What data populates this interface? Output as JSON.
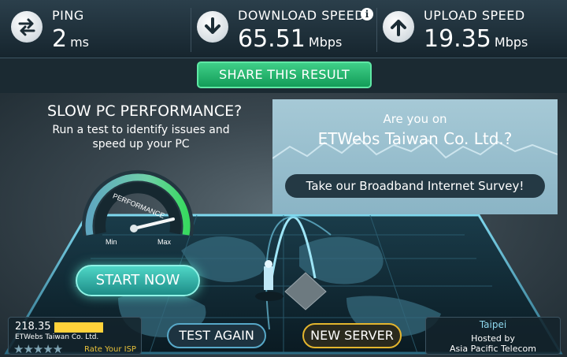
{
  "stats": {
    "ping": {
      "label": "PING",
      "value": "2",
      "unit": "ms",
      "icon": "ping-arrows-icon"
    },
    "download": {
      "label": "DOWNLOAD SPEED",
      "value": "65.51",
      "unit": "Mbps",
      "icon": "download-arrow-icon"
    },
    "upload": {
      "label": "UPLOAD SPEED",
      "value": "19.35",
      "unit": "Mbps",
      "icon": "upload-arrow-icon"
    },
    "info_glyph": "i"
  },
  "share": {
    "label": "SHARE THIS RESULT"
  },
  "promo": {
    "title": "SLOW PC PERFORMANCE?",
    "subtitle": "Run a test to identify issues and speed up your PC",
    "gauge": {
      "label": "PERFORMANCE",
      "min_label": "Min",
      "max_label": "Max"
    },
    "start_label": "START NOW"
  },
  "survey": {
    "line1": "Are you on",
    "line2": "ETWebs Taiwan Co. Ltd.?",
    "button": "Take our Broadband Internet Survey!"
  },
  "footer": {
    "isp": {
      "ip": "218.35",
      "name": "ETWebs Taiwan Co. Ltd.",
      "rate_label": "Rate Your ISP",
      "stars": "★★★★★"
    },
    "test_again": "TEST AGAIN",
    "new_server": "NEW SERVER",
    "host": {
      "city": "Taipei",
      "hosted_by": "Hosted by",
      "org": "Asia Pacific Telecom"
    }
  },
  "colors": {
    "accent_green": "#2fbf78",
    "accent_teal": "#3cc8bb",
    "accent_gold": "#e3b52e"
  }
}
